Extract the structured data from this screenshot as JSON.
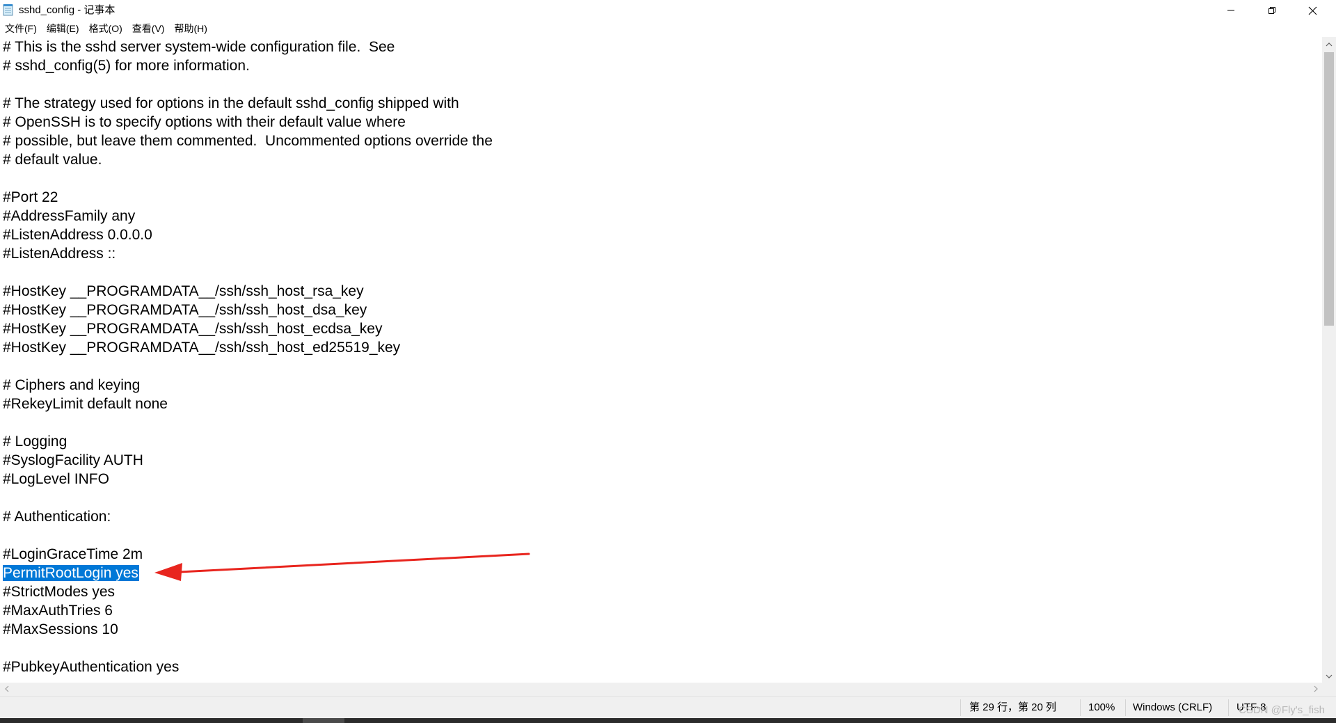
{
  "window": {
    "title": "sshd_config - 记事本",
    "app_icon": "notepad-icon",
    "controls": {
      "minimize_icon": "minimize-icon",
      "maximize_icon": "restore-icon",
      "close_icon": "close-icon"
    }
  },
  "menu": {
    "items": [
      {
        "label": "文件(F)"
      },
      {
        "label": "编辑(E)"
      },
      {
        "label": "格式(O)"
      },
      {
        "label": "查看(V)"
      },
      {
        "label": "帮助(H)"
      }
    ]
  },
  "editor": {
    "lines": [
      "# This is the sshd server system-wide configuration file.  See",
      "# sshd_config(5) for more information.",
      "",
      "# The strategy used for options in the default sshd_config shipped with",
      "# OpenSSH is to specify options with their default value where",
      "# possible, but leave them commented.  Uncommented options override the",
      "# default value.",
      "",
      "#Port 22",
      "#AddressFamily any",
      "#ListenAddress 0.0.0.0",
      "#ListenAddress ::",
      "",
      "#HostKey __PROGRAMDATA__/ssh/ssh_host_rsa_key",
      "#HostKey __PROGRAMDATA__/ssh/ssh_host_dsa_key",
      "#HostKey __PROGRAMDATA__/ssh/ssh_host_ecdsa_key",
      "#HostKey __PROGRAMDATA__/ssh/ssh_host_ed25519_key",
      "",
      "# Ciphers and keying",
      "#RekeyLimit default none",
      "",
      "# Logging",
      "#SyslogFacility AUTH",
      "#LogLevel INFO",
      "",
      "# Authentication:",
      "",
      "#LoginGraceTime 2m",
      "PermitRootLogin yes",
      "#StrictModes yes",
      "#MaxAuthTries 6",
      "#MaxSessions 10",
      "",
      "#PubkeyAuthentication yes"
    ],
    "selected_line_index": 28,
    "selection_color": "#0078d7",
    "annotation_arrow_color": "#e8251e"
  },
  "statusbar": {
    "position": "第 29 行，第 20 列",
    "zoom": "100%",
    "line_ending": "Windows (CRLF)",
    "encoding": "UTF-8"
  },
  "watermark": "CSDN @Fly's_fish"
}
